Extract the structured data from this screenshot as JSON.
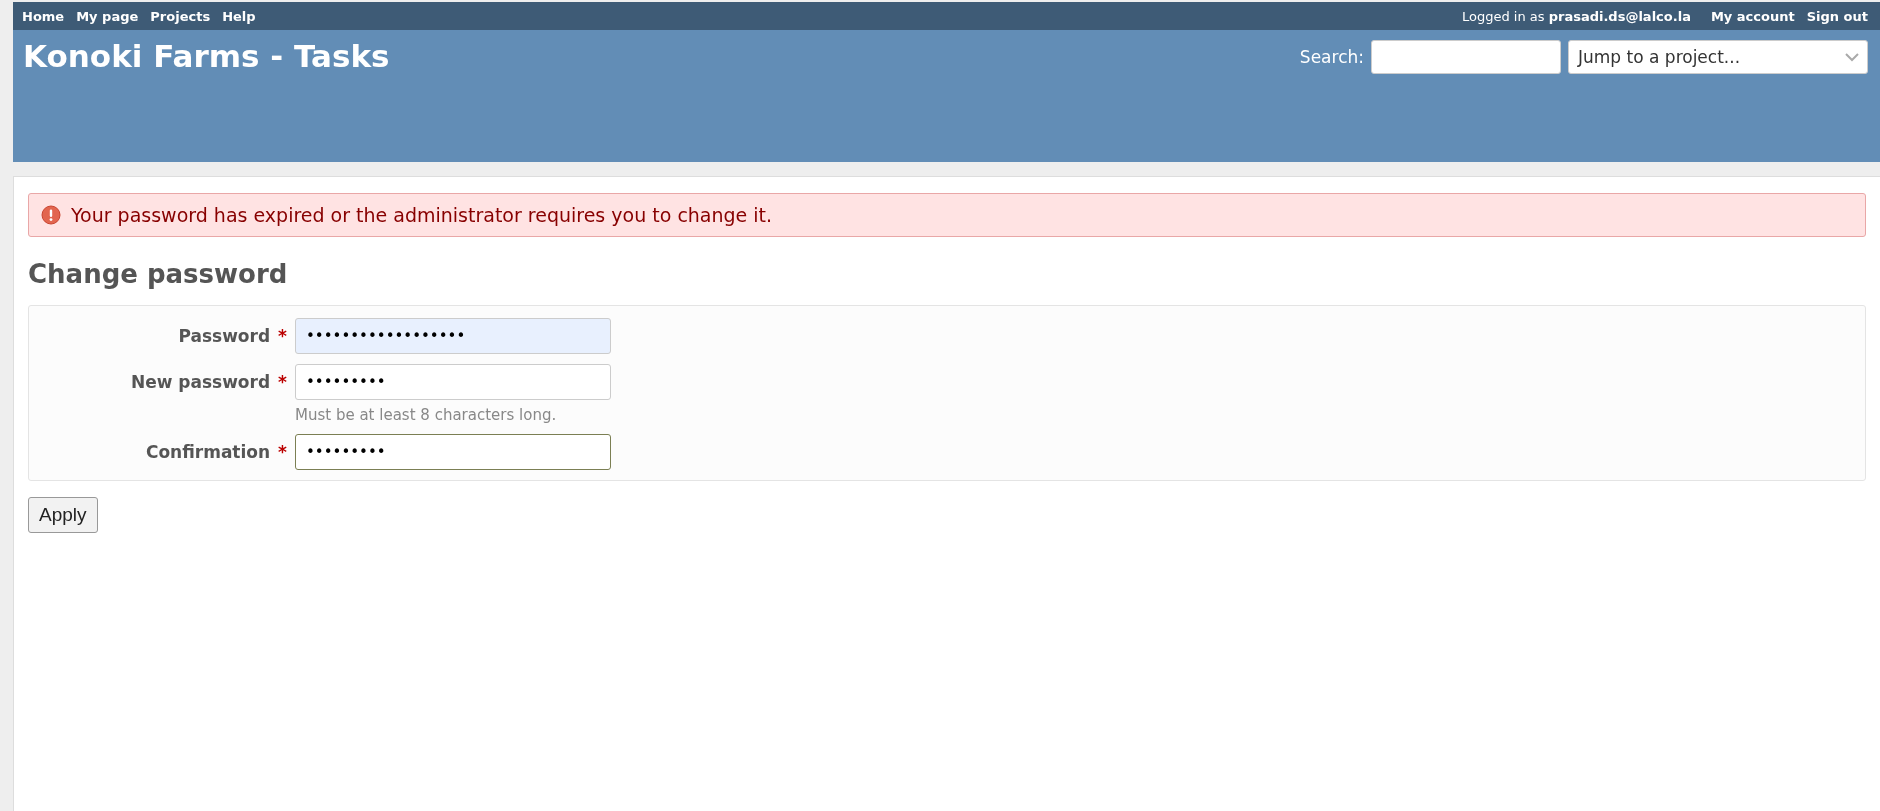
{
  "top_menu": {
    "items": [
      {
        "label": "Home"
      },
      {
        "label": "My page"
      },
      {
        "label": "Projects"
      },
      {
        "label": "Help"
      }
    ],
    "logged_in": {
      "prefix": "Logged in as",
      "user": "prasadi.ds@lalco.la"
    },
    "account_items": [
      {
        "label": "My account"
      },
      {
        "label": "Sign out"
      }
    ]
  },
  "header": {
    "title": "Konoki Farms - Tasks",
    "search": {
      "label": "Search:"
    },
    "project_jump": {
      "value": "Jump to a project..."
    }
  },
  "flash": {
    "kind": "error",
    "message": "Your password has expired or the administrator requires you to change it."
  },
  "heading": "Change password",
  "fields": [
    {
      "label": "Password",
      "required_mark": "*",
      "value": "••••••••••••••••••",
      "autofilled": true,
      "focused": false
    },
    {
      "label": "New password",
      "required_mark": "*",
      "value": "•••••••••",
      "autofilled": false,
      "focused": false,
      "hint": "Must be at least 8 characters long."
    },
    {
      "label": "Confirmation",
      "required_mark": "*",
      "value": "•••••••••",
      "autofilled": false,
      "focused": true
    }
  ],
  "submit": {
    "label": "Apply"
  }
}
